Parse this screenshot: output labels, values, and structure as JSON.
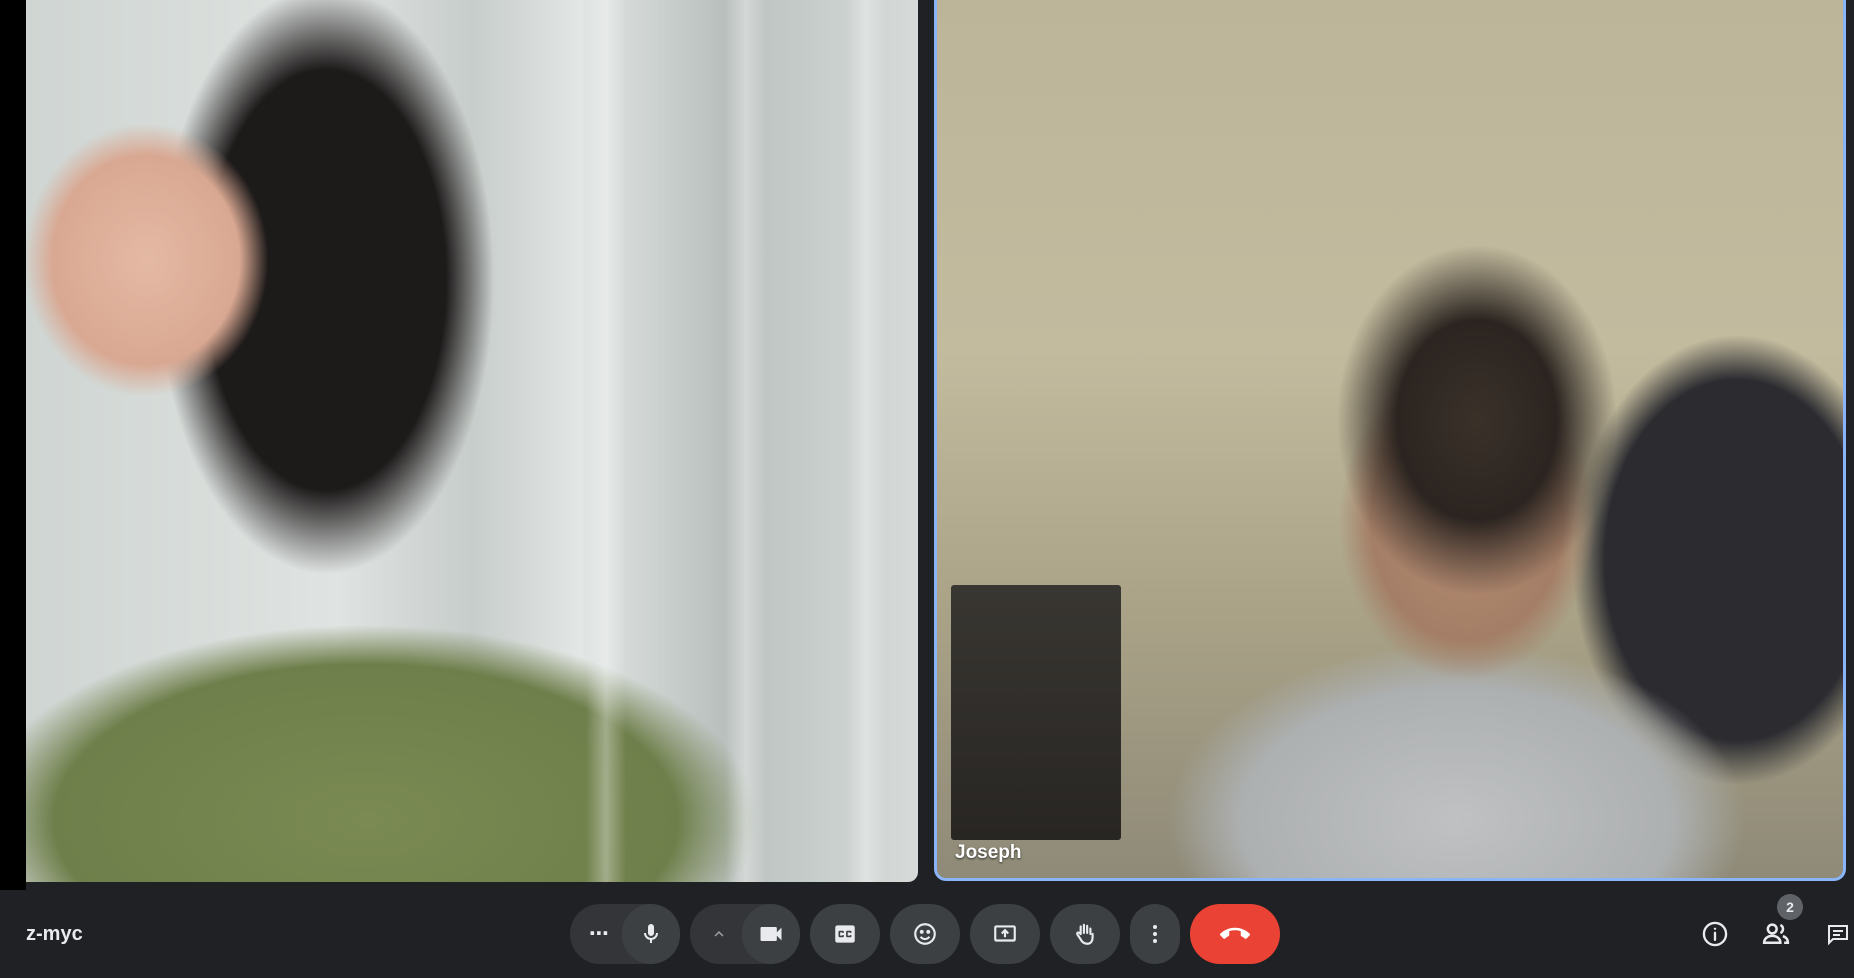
{
  "meeting": {
    "code": "z-myc"
  },
  "participants": [
    {
      "name": ""
    },
    {
      "name": "Joseph"
    }
  ],
  "toolbar": {
    "more_options_glyph": "⋯",
    "participants_count": "2"
  },
  "icons": [
    "more-horizontal-icon",
    "microphone-icon",
    "chevron-up-icon",
    "video-camera-icon",
    "captions-icon",
    "emoji-reaction-icon",
    "present-screen-icon",
    "raise-hand-icon",
    "more-vertical-icon",
    "end-call-icon",
    "info-icon",
    "people-icon",
    "chat-icon"
  ],
  "colors": {
    "background": "#202124",
    "button": "#3c4043",
    "end_call": "#ea4335",
    "active_speaker_border": "#8ab4f8"
  }
}
